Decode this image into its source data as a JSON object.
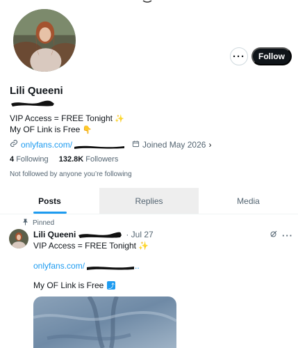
{
  "profile": {
    "display_name": "Lili Queeni",
    "bio_line1": "VIP Access = FREE Tonight",
    "bio_emoji1": "✨",
    "bio_line2": "My OF Link is Free",
    "bio_emoji2": "👇",
    "website": "onlyfans.com/",
    "joined": "Joined May 2026",
    "following_count": "4",
    "following_label": "Following",
    "followers_count": "132.8K",
    "followers_label": "Followers",
    "not_followed_text": "Not followed by anyone you’re following"
  },
  "actions": {
    "more_label": "···",
    "follow_label": "Follow"
  },
  "tabs": [
    {
      "label": "Posts",
      "active": true
    },
    {
      "label": "Replies",
      "active": false
    },
    {
      "label": "Media",
      "active": false
    }
  ],
  "post": {
    "pinned_label": "Pinned",
    "author": "Lili Queeni",
    "date": "· Jul 27",
    "line1": "VIP Access = FREE Tonight",
    "line1_emoji": "✨",
    "link": "onlyfans.com/",
    "link_suffix": "..",
    "line3": "My OF Link is Free",
    "line3_icon": "⤴",
    "more_label": "···"
  },
  "icons": {
    "link": "link-icon",
    "calendar": "calendar-icon",
    "pin": "pin-icon",
    "grok": "grok-icon",
    "more": "more-icon"
  },
  "colors": {
    "accent": "#1d9bf0",
    "text": "#0f1419",
    "muted": "#536471",
    "follow_bg": "#0f1419"
  }
}
